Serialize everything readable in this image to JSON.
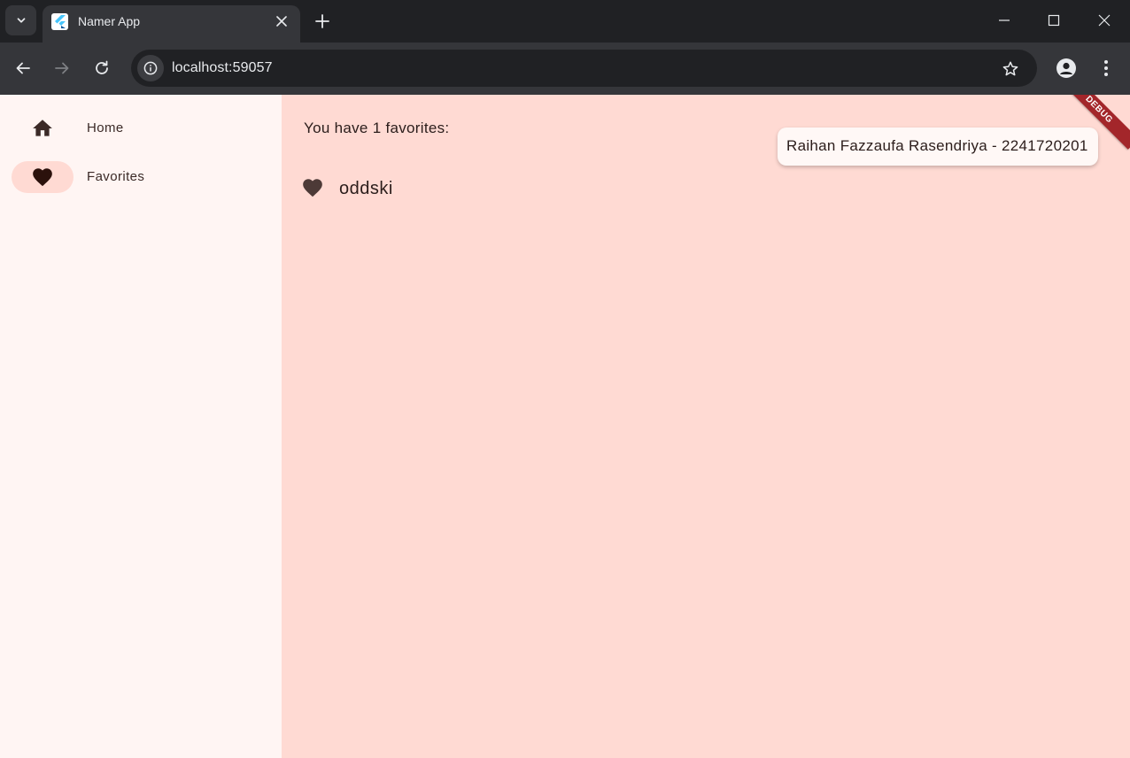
{
  "browser": {
    "tab_title": "Namer App",
    "url": "localhost:59057",
    "icons": [
      "tab-search-icon",
      "flutter-logo-icon",
      "close-icon",
      "plus-icon",
      "minimize-icon",
      "maximize-icon",
      "window-close-icon",
      "back-arrow-icon",
      "forward-arrow-icon",
      "reload-icon",
      "info-icon",
      "star-outline-icon",
      "profile-icon",
      "more-vert-icon"
    ]
  },
  "rail": {
    "items": [
      {
        "label": "Home",
        "icon": "home-icon",
        "selected": false
      },
      {
        "label": "Favorites",
        "icon": "heart-icon",
        "selected": true
      }
    ]
  },
  "favorites_page": {
    "count_text": "You have 1 favorites:",
    "items": [
      {
        "name": "oddski",
        "icon": "heart-icon"
      }
    ]
  },
  "name_chip": "Raihan Fazzaufa Rasendriya - 2241720201",
  "debug_banner": "DEBUG",
  "colors": {
    "rail_bg": "#fff5f3",
    "content_bg": "#ffdad3",
    "indicator": "#ffdad3",
    "icon_dark": "#3b2a27",
    "debug_red": "#a3262a"
  }
}
